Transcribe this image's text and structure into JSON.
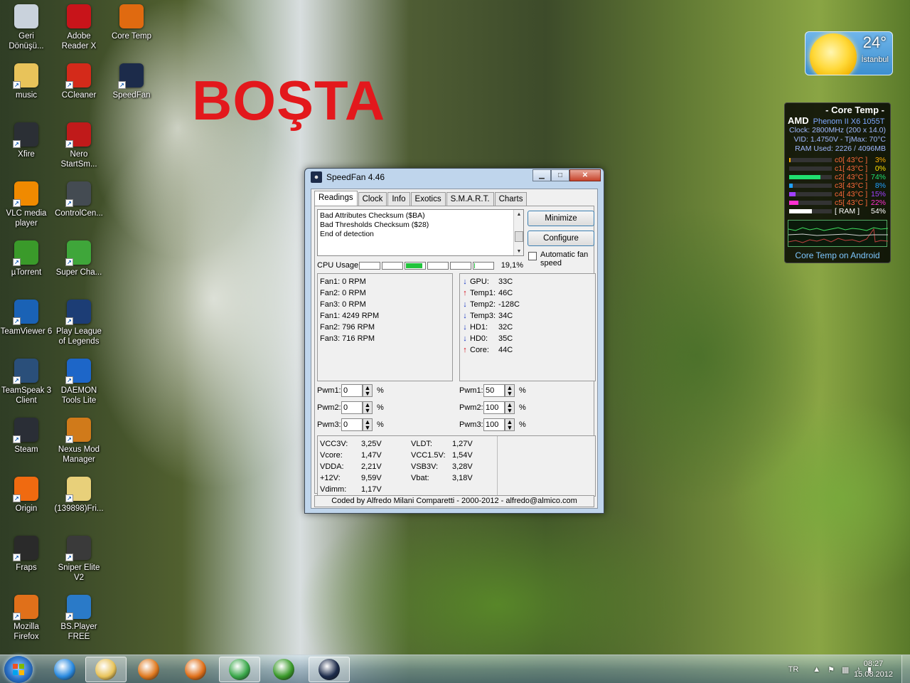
{
  "desktop": {
    "big_text": "BOŞTA",
    "icons": [
      {
        "label": "Geri Dönüşü...",
        "icon": "recycle-bin-icon",
        "color": "#c9d2dc"
      },
      {
        "label": "Adobe Reader X",
        "icon": "adobe-reader-icon",
        "color": "#c8141a"
      },
      {
        "label": "Core Temp",
        "icon": "core-temp-icon",
        "color": "#e06a10"
      },
      {
        "label": "music",
        "icon": "folder-icon",
        "color": "#e8c35a"
      },
      {
        "label": "CCleaner",
        "icon": "ccleaner-icon",
        "color": "#d42a1a"
      },
      {
        "label": "SpeedFan",
        "icon": "speedfan-icon",
        "color": "#1c2b4a"
      },
      {
        "label": "Xfire",
        "icon": "xfire-icon",
        "color": "#2b2f35"
      },
      {
        "label": "Nero StartSm...",
        "icon": "nero-icon",
        "color": "#c01a1a"
      },
      {
        "label": "VLC media player",
        "icon": "vlc-icon",
        "color": "#f08a00"
      },
      {
        "label": "ControlCen...",
        "icon": "control-center-icon",
        "color": "#444b52"
      },
      {
        "label": "µTorrent",
        "icon": "utorrent-icon",
        "color": "#3a9a2a"
      },
      {
        "label": "Super Cha...",
        "icon": "super-charger-icon",
        "color": "#3fa63a"
      },
      {
        "label": "TeamViewer 6",
        "icon": "teamviewer-icon",
        "color": "#1a62b5"
      },
      {
        "label": "Play League of Legends",
        "icon": "league-icon",
        "color": "#1c3d75"
      },
      {
        "label": "TeamSpeak 3 Client",
        "icon": "teamspeak-icon",
        "color": "#2a4f7a"
      },
      {
        "label": "DAEMON Tools Lite",
        "icon": "daemon-tools-icon",
        "color": "#1d66c8"
      },
      {
        "label": "Steam",
        "icon": "steam-icon",
        "color": "#2a2e36"
      },
      {
        "label": "Nexus Mod Manager",
        "icon": "nexus-icon",
        "color": "#d07a1a"
      },
      {
        "label": "Origin",
        "icon": "origin-icon",
        "color": "#f06a10"
      },
      {
        "label": "(139898)Fri...",
        "icon": "file-icon",
        "color": "#e8d07a"
      },
      {
        "label": "Fraps",
        "icon": "fraps-icon",
        "color": "#2a2a2a"
      },
      {
        "label": "Sniper Elite V2",
        "icon": "sniper-elite-icon",
        "color": "#3a3a3a"
      },
      {
        "label": "Mozilla Firefox",
        "icon": "firefox-icon",
        "color": "#e0701a"
      },
      {
        "label": "BS.Player FREE",
        "icon": "bsplayer-icon",
        "color": "#2a7ac8"
      }
    ]
  },
  "weather": {
    "temp": "24°",
    "city": "İstanbul"
  },
  "coretemp_gadget": {
    "title": "- Core Temp -",
    "brand": "AMD",
    "model": "Phenom II X6 1055T",
    "clock": "Clock: 2800MHz (200 x 14.0)",
    "vid": "VID: 1.4750V - TjMax: 70°C",
    "ram": "RAM Used: 2226 / 4096MB",
    "cores": [
      {
        "label": "c0[ 43°C ]",
        "pct": "3%",
        "load": 0.03,
        "color": "#ffb000"
      },
      {
        "label": "c1[ 43°C ]",
        "pct": "0%",
        "load": 0.0,
        "color": "#ffe000"
      },
      {
        "label": "c2[ 43°C ]",
        "pct": "74%",
        "load": 0.74,
        "color": "#20e070"
      },
      {
        "label": "c3[ 43°C ]",
        "pct": "8%",
        "load": 0.08,
        "color": "#20a0ff"
      },
      {
        "label": "c4[ 43°C ]",
        "pct": "15%",
        "load": 0.15,
        "color": "#a040ff"
      },
      {
        "label": "c5[ 43°C ]",
        "pct": "22%",
        "load": 0.22,
        "color": "#ff30d0"
      },
      {
        "label": "[ RAM ]",
        "pct": "54%",
        "load": 0.54,
        "color": "#ffffff"
      }
    ],
    "footer": "Core Temp on Android"
  },
  "speedfan": {
    "title": "SpeedFan 4.46",
    "tabs": [
      "Readings",
      "Clock",
      "Info",
      "Exotics",
      "S.M.A.R.T.",
      "Charts"
    ],
    "log": [
      "Bad Attributes Checksum ($BA)",
      "Bad Thresholds Checksum ($28)",
      "End of detection"
    ],
    "minimize_label": "Minimize",
    "configure_label": "Configure",
    "auto_fan_label": "Automatic fan speed",
    "cpu_usage_label": "CPU Usage",
    "cpu_usage_value": "19,1%",
    "cpu_segments": [
      0,
      0,
      0.9,
      0,
      0,
      0.1
    ],
    "fans": [
      "Fan1: 0 RPM",
      "Fan2: 0 RPM",
      "Fan3: 0 RPM",
      "Fan1: 4249 RPM",
      "Fan2: 796 RPM",
      "Fan3: 716 RPM"
    ],
    "temps": [
      {
        "dir": "down",
        "name": "GPU:",
        "value": "33C"
      },
      {
        "dir": "up",
        "name": "Temp1:",
        "value": "46C"
      },
      {
        "dir": "down",
        "name": "Temp2:",
        "value": "-128C"
      },
      {
        "dir": "down",
        "name": "Temp3:",
        "value": "34C"
      },
      {
        "dir": "down",
        "name": "HD1:",
        "value": "32C"
      },
      {
        "dir": "down",
        "name": "HD0:",
        "value": "35C"
      },
      {
        "dir": "up",
        "name": "Core:",
        "value": "44C"
      }
    ],
    "pwm_left": [
      {
        "label": "Pwm1:",
        "value": "0"
      },
      {
        "label": "Pwm2:",
        "value": "0"
      },
      {
        "label": "Pwm3:",
        "value": "0"
      }
    ],
    "pwm_right": [
      {
        "label": "Pwm1:",
        "value": "50"
      },
      {
        "label": "Pwm2:",
        "value": "100"
      },
      {
        "label": "Pwm3:",
        "value": "100"
      }
    ],
    "pct_sign": "%",
    "volts_left": [
      {
        "name": "VCC3V:",
        "value": "3,25V"
      },
      {
        "name": "Vcore:",
        "value": "1,47V"
      },
      {
        "name": "VDDA:",
        "value": "2,21V"
      },
      {
        "name": "+12V:",
        "value": "9,59V"
      },
      {
        "name": "Vdimm:",
        "value": "1,17V"
      }
    ],
    "volts_right": [
      {
        "name": "VLDT:",
        "value": "1,27V"
      },
      {
        "name": "VCC1.5V:",
        "value": "1,54V"
      },
      {
        "name": "VSB3V:",
        "value": "3,28V"
      },
      {
        "name": "Vbat:",
        "value": "3,18V"
      }
    ],
    "footer": "Coded by Alfredo Milani Comparetti - 2000-2012 - alfredo@almico.com"
  },
  "taskbar": {
    "apps": [
      {
        "name": "internet-explorer-icon",
        "color": "#2a8ae0"
      },
      {
        "name": "explorer-icon",
        "color": "#e8c35a"
      },
      {
        "name": "media-player-icon",
        "color": "#e07a20"
      },
      {
        "name": "firefox-icon",
        "color": "#e0701a"
      },
      {
        "name": "chrome-icon",
        "color": "#3aa84a"
      },
      {
        "name": "utorrent-icon",
        "color": "#3a9a2a"
      },
      {
        "name": "speedfan-icon",
        "color": "#1c2b4a"
      }
    ],
    "lang": "TR",
    "time": "08:27",
    "date": "15.08.2012"
  }
}
